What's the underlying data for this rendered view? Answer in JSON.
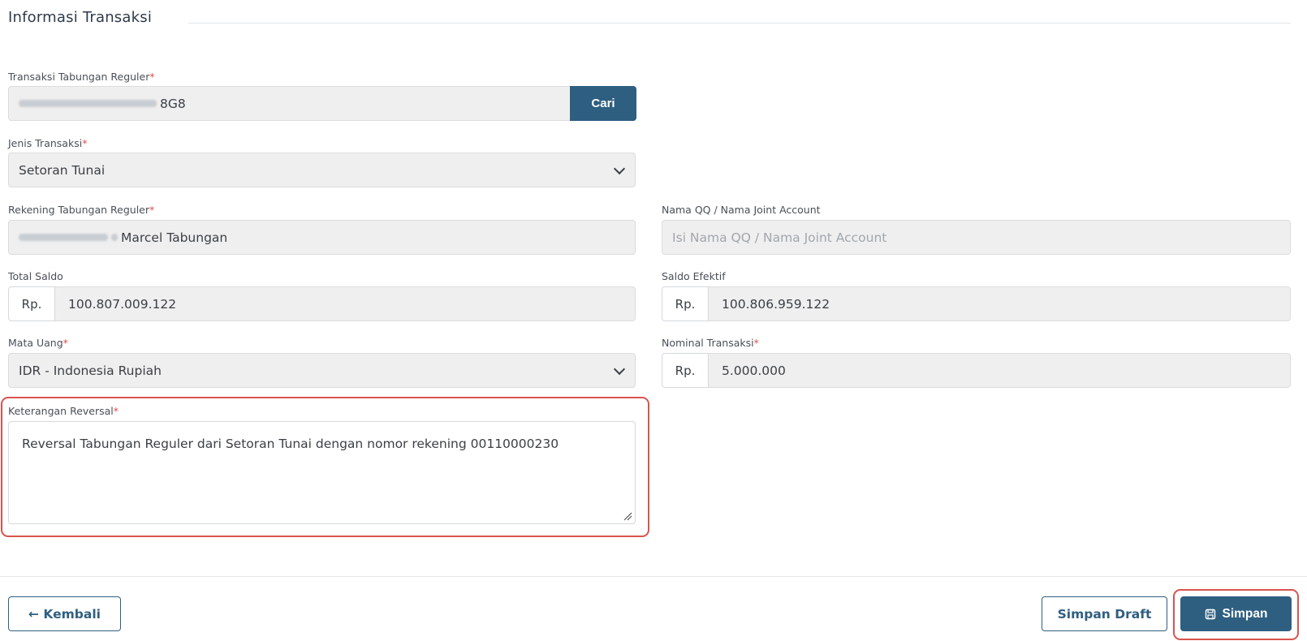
{
  "section": {
    "title": "Informasi Transaksi"
  },
  "transaksi_tabungan": {
    "label": "Transaksi Tabungan Reguler",
    "required_mark": "*",
    "value_suffix": "8G8",
    "search_button": "Cari"
  },
  "jenis_transaksi": {
    "label": "Jenis Transaksi",
    "required_mark": "*",
    "value": "Setoran Tunai"
  },
  "rekening": {
    "label": "Rekening Tabungan Reguler",
    "required_mark": "*",
    "value_name": "Marcel Tabungan"
  },
  "nama_qq": {
    "label": "Nama QQ / Nama Joint Account",
    "placeholder": "Isi Nama QQ / Nama Joint Account"
  },
  "total_saldo": {
    "label": "Total Saldo",
    "prefix": "Rp.",
    "value": "100.807.009.122"
  },
  "saldo_efektif": {
    "label": "Saldo Efektif",
    "prefix": "Rp.",
    "value": "100.806.959.122"
  },
  "mata_uang": {
    "label": "Mata Uang",
    "required_mark": "*",
    "value": "IDR - Indonesia Rupiah"
  },
  "nominal_transaksi": {
    "label": "Nominal Transaksi",
    "required_mark": "*",
    "prefix": "Rp.",
    "value": "5.000.000"
  },
  "keterangan": {
    "label": "Keterangan Reversal",
    "required_mark": "*",
    "value": "Reversal Tabungan Reguler dari Setoran Tunai dengan nomor rekening 00110000230"
  },
  "footer": {
    "back_label": "← Kembali",
    "draft_label": "Simpan Draft",
    "save_label": "Simpan"
  },
  "colors": {
    "primary": "#2f5f80",
    "required": "#e24c4c",
    "highlight": "#d9534f"
  }
}
